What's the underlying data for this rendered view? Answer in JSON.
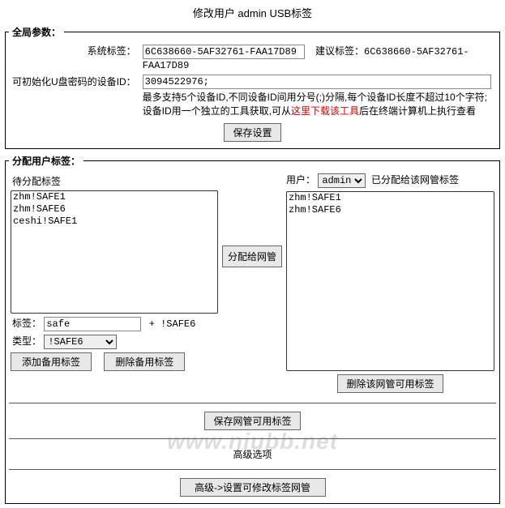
{
  "title": "修改用户 admin USB标签",
  "global": {
    "legend": "全局参数：",
    "system_tag_label": "系统标签：",
    "system_tag_value": "6C638660-5AF32761-FAA17D89",
    "suggested_tag_label": "建议标签：",
    "suggested_tag_value": "6C638660-5AF32761-FAA17D89",
    "device_id_label": "可初始化U盘密码的设备ID：",
    "device_id_value": "3094522976;",
    "device_hint_1": "最多支持5个设备ID,不同设备ID间用分号(;)分隔,每个设备ID长度不超过10个字符;",
    "device_hint_2a": "设备ID用一个独立的工具获取,可从",
    "device_hint_2_red": "这里下载该工具",
    "device_hint_2b": "后在终端计算机上执行查看",
    "save_btn": "保存设置"
  },
  "assign": {
    "legend": "分配用户标签：",
    "pending_label": "待分配标签",
    "pending_items": [
      "zhm!SAFE1",
      "zhm!SAFE6",
      "ceshi!SAFE1"
    ],
    "assign_btn": "分配给网管",
    "user_label": "用户：",
    "user_options": [
      "admin"
    ],
    "assigned_label": "已分配给该网管标签",
    "assigned_items": [
      "zhm!SAFE1",
      "zhm!SAFE6"
    ],
    "tag_label": "标签：",
    "tag_value": "safe",
    "tag_suffix": "+ !SAFE6",
    "type_label": "类型：",
    "type_options": [
      "!SAFE6"
    ],
    "add_spare_btn": "添加备用标签",
    "del_spare_btn": "删除备用标签",
    "del_netadmin_btn": "删除该网管可用标签",
    "save_netadmin_btn": "保存网管可用标签",
    "advanced_label": "高级选项",
    "advanced_btn": "高级->设置可修改标签网管"
  },
  "watermark": "www.niubb.net"
}
